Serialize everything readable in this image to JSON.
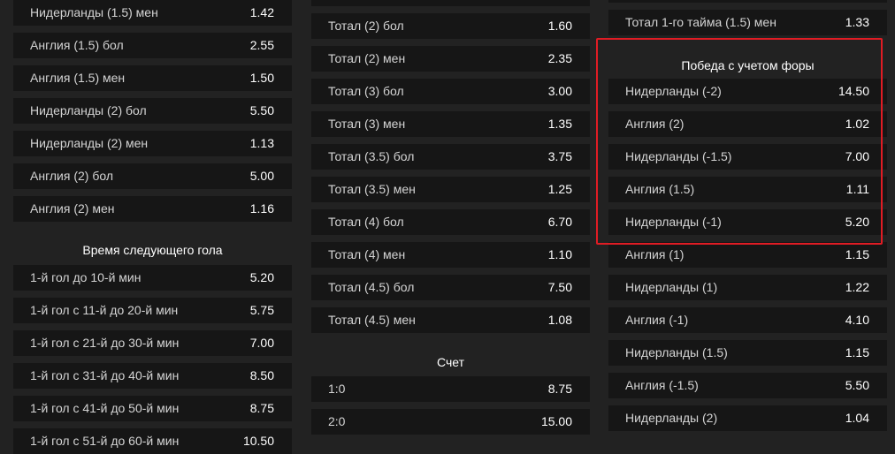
{
  "columns": [
    {
      "blocks": [
        {
          "type": "rows",
          "rows": [
            {
              "label": "Нидерланды (1.5) мен",
              "odds": "1.42"
            },
            {
              "label": "Англия (1.5) бол",
              "odds": "2.55"
            },
            {
              "label": "Англия (1.5) мен",
              "odds": "1.50"
            },
            {
              "label": "Нидерланды (2) бол",
              "odds": "5.50"
            },
            {
              "label": "Нидерланды (2) мен",
              "odds": "1.13"
            },
            {
              "label": "Англия (2) бол",
              "odds": "5.00"
            },
            {
              "label": "Англия (2) мен",
              "odds": "1.16"
            }
          ]
        },
        {
          "type": "section",
          "title": "Время следующего гола",
          "rows": [
            {
              "label": "1-й гол до 10-й мин",
              "odds": "5.20"
            },
            {
              "label": "1-й гол с 11-й до 20-й мин",
              "odds": "5.75"
            },
            {
              "label": "1-й гол с 21-й до 30-й мин",
              "odds": "7.00"
            },
            {
              "label": "1-й гол с 31-й до 40-й мин",
              "odds": "8.50"
            },
            {
              "label": "1-й гол с 41-й до 50-й мин",
              "odds": "8.75"
            },
            {
              "label": "1-й гол с 51-й до 60-й мин",
              "odds": "10.50"
            }
          ]
        }
      ]
    },
    {
      "blocks": [
        {
          "type": "rows",
          "rows": [
            {
              "label": "",
              "odds": ""
            },
            {
              "label": "Тотал (2) бол",
              "odds": "1.60"
            },
            {
              "label": "Тотал (2) мен",
              "odds": "2.35"
            },
            {
              "label": "Тотал (3) бол",
              "odds": "3.00"
            },
            {
              "label": "Тотал (3) мен",
              "odds": "1.35"
            },
            {
              "label": "Тотал (3.5) бол",
              "odds": "3.75"
            },
            {
              "label": "Тотал (3.5) мен",
              "odds": "1.25"
            },
            {
              "label": "Тотал (4) бол",
              "odds": "6.70"
            },
            {
              "label": "Тотал (4) мен",
              "odds": "1.10"
            },
            {
              "label": "Тотал (4.5) бол",
              "odds": "7.50"
            },
            {
              "label": "Тотал (4.5) мен",
              "odds": "1.08"
            }
          ]
        },
        {
          "type": "section",
          "title": "Счет",
          "rows": [
            {
              "label": "1:0",
              "odds": "8.75"
            },
            {
              "label": "2:0",
              "odds": "15.00"
            }
          ]
        }
      ]
    },
    {
      "blocks": [
        {
          "type": "rows",
          "rows": [
            {
              "label": "",
              "odds": ""
            },
            {
              "label": "Тотал 1-го тайма (1.5) мен",
              "odds": "1.33"
            }
          ]
        },
        {
          "type": "section",
          "title": "Победа с учетом форы",
          "rows": [
            {
              "label": "Нидерланды (-2)",
              "odds": "14.50"
            },
            {
              "label": "Англия (2)",
              "odds": "1.02"
            },
            {
              "label": "Нидерланды (-1.5)",
              "odds": "7.00"
            },
            {
              "label": "Англия (1.5)",
              "odds": "1.11"
            },
            {
              "label": "Нидерланды (-1)",
              "odds": "5.20"
            },
            {
              "label": "Англия (1)",
              "odds": "1.15"
            },
            {
              "label": "Нидерланды (1)",
              "odds": "1.22"
            },
            {
              "label": "Англия (-1)",
              "odds": "4.10"
            },
            {
              "label": "Нидерланды (1.5)",
              "odds": "1.15"
            },
            {
              "label": "Англия (-1.5)",
              "odds": "5.50"
            },
            {
              "label": "Нидерланды (2)",
              "odds": "1.04"
            }
          ]
        }
      ]
    }
  ],
  "colors": {
    "page_bg": "#222222",
    "row_bg": "#161616",
    "highlight_border": "#e01c24"
  }
}
